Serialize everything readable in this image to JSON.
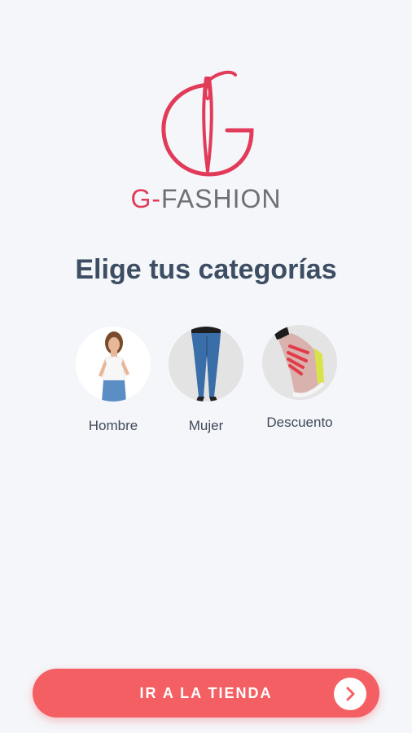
{
  "brand": {
    "prefix": "G",
    "separator": "-",
    "name": "FASHION",
    "primary_color": "#e23b5a",
    "text_color": "#6f6f74"
  },
  "title": "Elige tus categorías",
  "categories": [
    {
      "label": "Hombre",
      "image": "woman-white-top-jeans-photo"
    },
    {
      "label": "Mujer",
      "image": "blue-jeans-legs-photo"
    },
    {
      "label": "Descuento",
      "image": "sneaker-photo"
    }
  ],
  "cta": {
    "label": "IR A LA TIENDA",
    "icon": "chevron-right-icon",
    "color": "#f45f63"
  }
}
